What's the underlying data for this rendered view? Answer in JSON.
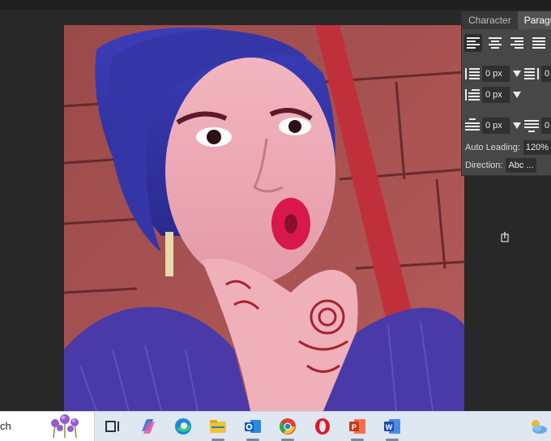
{
  "panel": {
    "tabs": [
      {
        "label": "Character",
        "active": false
      },
      {
        "label": "Paragraph",
        "active": true
      }
    ],
    "alignment": [
      "align-left",
      "align-center",
      "align-right",
      "justify"
    ],
    "indent_left": "0 px",
    "indent_right": "0",
    "indent_first": "0 px",
    "space_before": "0 px",
    "space_after": "0",
    "auto_leading_label": "Auto Leading:",
    "auto_leading_value": "120%",
    "direction_label": "Direction:",
    "direction_value": "Abc ..."
  },
  "taskbar": {
    "search_text": "ch",
    "apps": [
      "copilot",
      "edge",
      "file-explorer",
      "outlook",
      "chrome",
      "opera",
      "powerpoint",
      "word"
    ],
    "weather_icon": "weather-cloud-sun-icon"
  },
  "colors": {
    "workspace": "#282828",
    "panel": "#474747",
    "taskbar": "#dfe7f0"
  }
}
